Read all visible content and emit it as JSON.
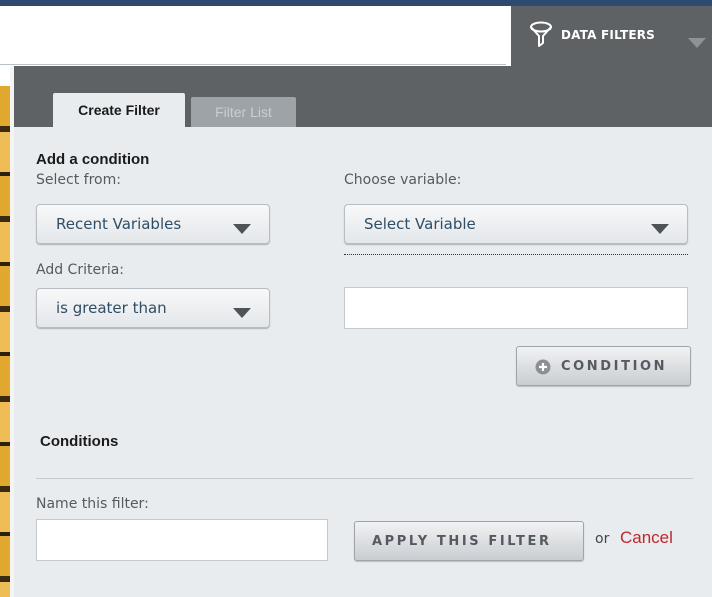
{
  "header": {
    "data_filters_label": "DATA FILTERS"
  },
  "tabs": [
    {
      "label": "Create Filter",
      "active": true
    },
    {
      "label": "Filter List",
      "active": false
    }
  ],
  "condition": {
    "heading": "Add a condition",
    "select_from_label": "Select from:",
    "select_from_value": "Recent Variables",
    "choose_variable_label": "Choose variable:",
    "choose_variable_value": "Select Variable",
    "add_criteria_label": "Add Criteria:",
    "criteria_value": "is greater than",
    "criteria_input_value": "",
    "add_condition_button": "CONDITION"
  },
  "conditions": {
    "heading": "Conditions"
  },
  "filter": {
    "name_label": "Name this filter:",
    "name_value": "",
    "apply_button": "APPLY THIS FILTER",
    "or_text": "or",
    "cancel_link": "Cancel"
  },
  "colors": {
    "header_gray": "#5e6265",
    "panel_bg": "#e9ecef",
    "cancel_red": "#c0272d",
    "dropdown_text": "#2f4e66"
  },
  "icons": {
    "filter": "funnel-icon",
    "dropdown": "caret-down-icon",
    "add": "plus-circle-icon"
  }
}
